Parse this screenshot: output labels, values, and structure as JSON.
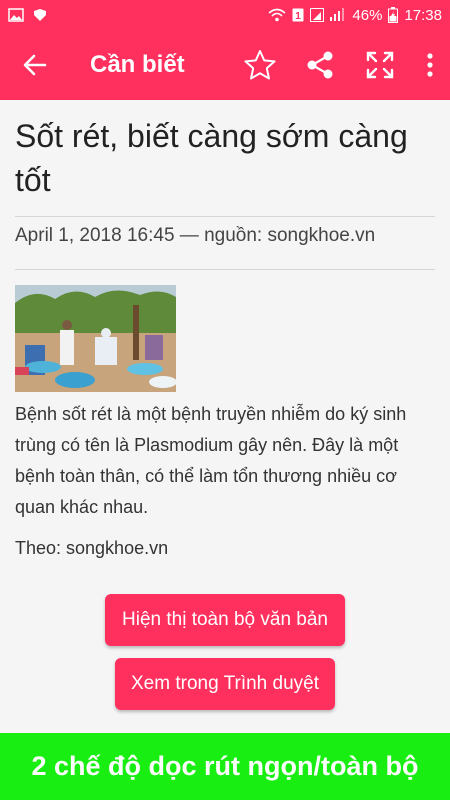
{
  "status_bar": {
    "battery": "46%",
    "time": "17:38",
    "icons": [
      "image-icon",
      "notification-icon",
      "wifi-icon",
      "sim1-icon",
      "signal-icon",
      "battery-icon"
    ]
  },
  "app_bar": {
    "title": "Cần biết",
    "icons": [
      "back-arrow-icon",
      "star-icon",
      "share-icon",
      "fullscreen-icon",
      "more-vert-icon"
    ]
  },
  "article": {
    "title": "Sốt rét, biết càng sớm càng tốt",
    "meta": "April 1, 2018 16:45 — nguồn: songkhoe.vn",
    "body": "Bệnh sốt rét là một bệnh truyền nhiễm do ký sinh trùng có tên là Plasmodium gây nên. Đây là một bệnh toàn thân, có thể làm tổn thương nhiều cơ quan khác nhau.",
    "source": "Theo: songkhoe.vn"
  },
  "buttons": {
    "show_full": "Hiện thị toàn bộ văn bản",
    "open_browser": "Xem trong Trình duyệt"
  },
  "banner": {
    "text": "2 chế độ dọc rút ngọn/toàn bộ"
  },
  "colors": {
    "accent": "#ff2f5e",
    "banner": "#19ee13"
  }
}
